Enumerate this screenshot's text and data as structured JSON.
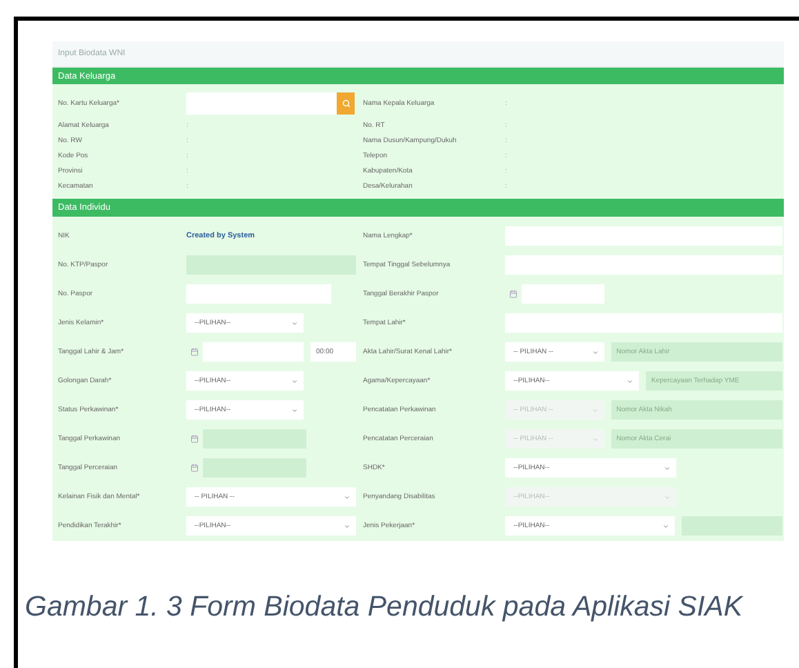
{
  "page_title": "Input Biodata WNI",
  "sections": [
    {
      "title": "Data Keluarga",
      "kind": "info",
      "rows": [
        {
          "left": {
            "label": "No. Kartu Keluarga*",
            "controls": [
              {
                "kind": "search"
              }
            ]
          },
          "right": {
            "label": "Nama Kepala Keluarga",
            "controls": [
              {
                "kind": "static",
                "text": ":"
              }
            ]
          }
        },
        {
          "left": {
            "label": "Alamat Keluarga",
            "controls": [
              {
                "kind": "static",
                "text": ":"
              }
            ]
          },
          "right": {
            "label": "No. RT",
            "controls": [
              {
                "kind": "static",
                "text": ":"
              }
            ]
          }
        },
        {
          "left": {
            "label": "No. RW",
            "controls": [
              {
                "kind": "static",
                "text": ":"
              }
            ]
          },
          "right": {
            "label": "Nama Dusun/Kampung/Dukuh",
            "controls": [
              {
                "kind": "static",
                "text": ":"
              }
            ]
          }
        },
        {
          "left": {
            "label": "Kode Pos",
            "controls": [
              {
                "kind": "static",
                "text": ":"
              }
            ]
          },
          "right": {
            "label": "Telepon",
            "controls": [
              {
                "kind": "static",
                "text": ":"
              }
            ]
          }
        },
        {
          "left": {
            "label": "Provinsi",
            "controls": [
              {
                "kind": "static",
                "text": ":"
              }
            ]
          },
          "right": {
            "label": "Kabupaten/Kota",
            "controls": [
              {
                "kind": "static",
                "text": ":"
              }
            ]
          }
        },
        {
          "left": {
            "label": "Kecamatan",
            "controls": [
              {
                "kind": "static",
                "text": ":"
              }
            ]
          },
          "right": {
            "label": "Desa/Kelurahan",
            "controls": [
              {
                "kind": "static",
                "text": ":"
              }
            ]
          }
        }
      ]
    },
    {
      "title": "Data Individu",
      "kind": "form",
      "rows": [
        {
          "left": {
            "label": "NIK",
            "controls": [
              {
                "kind": "system",
                "text": "Created by System"
              }
            ]
          },
          "right": {
            "label": "Nama Lengkap*",
            "controls": [
              {
                "kind": "input",
                "disabled": false
              }
            ]
          }
        },
        {
          "left": {
            "label": "No. KTP/Paspor",
            "controls": [
              {
                "kind": "input",
                "disabled": true
              }
            ]
          },
          "right": {
            "label": "Tempat Tinggal Sebelumnya",
            "controls": [
              {
                "kind": "input",
                "disabled": false
              }
            ]
          }
        },
        {
          "left": {
            "label": "No. Paspor",
            "controls": [
              {
                "kind": "input",
                "disabled": false
              }
            ]
          },
          "right": {
            "label": "Tanggal Berakhir Paspor",
            "controls": [
              {
                "kind": "date",
                "disabled": false
              }
            ]
          }
        },
        {
          "left": {
            "label": "Jenis Kelamin*",
            "controls": [
              {
                "kind": "select",
                "text": "--PILIHAN--",
                "disabled": false
              }
            ]
          },
          "right": {
            "label": "Tempat Lahir*",
            "controls": [
              {
                "kind": "input",
                "disabled": false
              }
            ]
          }
        },
        {
          "left": {
            "label": "Tanggal Lahir & Jam*",
            "controls": [
              {
                "kind": "date",
                "disabled": false
              },
              {
                "kind": "input",
                "value": "00:00",
                "disabled": false
              }
            ]
          },
          "right": {
            "label": "Akta Lahir/Surat Kenal Lahir*",
            "controls": [
              {
                "kind": "select",
                "text": "-- PILIHAN --",
                "disabled": false
              },
              {
                "kind": "input",
                "placeholder": "Nomor Akta Lahir",
                "disabled": true
              }
            ]
          }
        },
        {
          "left": {
            "label": "Golongan Darah*",
            "controls": [
              {
                "kind": "select",
                "text": "--PILIHAN--",
                "disabled": false
              }
            ]
          },
          "right": {
            "label": "Agama/Kepercayaan*",
            "controls": [
              {
                "kind": "select",
                "text": "--PILIHAN--",
                "disabled": false
              },
              {
                "kind": "input",
                "placeholder": "Kepercayaan Terhadap YME",
                "disabled": true
              }
            ]
          }
        },
        {
          "left": {
            "label": "Status Perkawinan*",
            "controls": [
              {
                "kind": "select",
                "text": "--PILIHAN--",
                "disabled": false
              }
            ]
          },
          "right": {
            "label": "Pencatatan Perkawinan",
            "controls": [
              {
                "kind": "select",
                "text": "-- PILIHAN --",
                "disabled": true
              },
              {
                "kind": "input",
                "placeholder": "Nomor Akta Nikah",
                "disabled": true
              }
            ]
          }
        },
        {
          "left": {
            "label": "Tanggal Perkawinan",
            "controls": [
              {
                "kind": "date",
                "disabled": true
              }
            ]
          },
          "right": {
            "label": "Pencatatan Perceraian",
            "controls": [
              {
                "kind": "select",
                "text": "-- PILIHAN --",
                "disabled": true
              },
              {
                "kind": "input",
                "placeholder": "Nomor Akta Cerai",
                "disabled": true
              }
            ]
          }
        },
        {
          "left": {
            "label": "Tanggal Perceraian",
            "controls": [
              {
                "kind": "date",
                "disabled": true
              }
            ]
          },
          "right": {
            "label": "SHDK*",
            "controls": [
              {
                "kind": "select",
                "text": "--PILIHAN--",
                "disabled": false
              }
            ]
          }
        },
        {
          "left": {
            "label": "Kelainan Fisik dan Mental*",
            "controls": [
              {
                "kind": "select",
                "text": "-- PILIHAN --",
                "disabled": false
              }
            ]
          },
          "right": {
            "label": "Penyandang Disabilitas",
            "controls": [
              {
                "kind": "select",
                "text": "--PILIHAN--",
                "disabled": true
              }
            ]
          }
        },
        {
          "left": {
            "label": "Pendidikan Terakhir*",
            "controls": [
              {
                "kind": "select",
                "text": "--PILIHAN--",
                "disabled": false
              }
            ]
          },
          "right": {
            "label": "Jenis Pekerjaan*",
            "controls": [
              {
                "kind": "select",
                "text": "--PILIHAN--",
                "disabled": false
              },
              {
                "kind": "input",
                "disabled": true
              }
            ]
          }
        }
      ]
    }
  ],
  "caption": "Gambar 1. 3 Form Biodata Penduduk pada Aplikasi SIAK"
}
